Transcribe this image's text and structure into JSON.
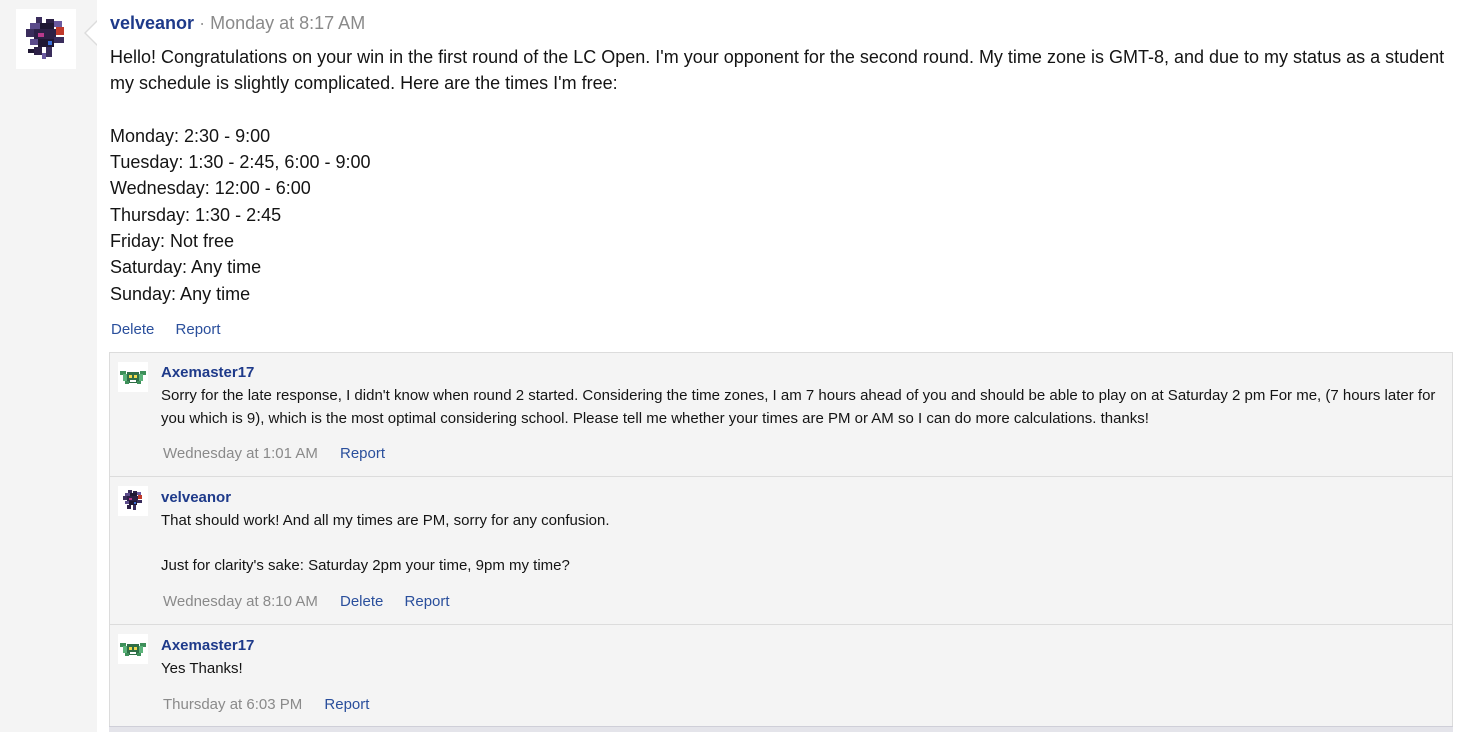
{
  "post": {
    "author": "velveanor",
    "separator": "·",
    "timestamp": "Monday at 8:17 AM",
    "intro": "Hello! Congratulations on your win in the first round of the LC Open. I'm your opponent for the second round. My time zone is GMT-8, and due to my status as a student my schedule is slightly complicated. Here are the times I'm free:",
    "schedule": [
      "Monday: 2:30 - 9:00",
      "Tuesday: 1:30 - 2:45, 6:00 - 9:00",
      "Wednesday: 12:00 - 6:00",
      "Thursday: 1:30 - 2:45",
      "Friday: Not free",
      "Saturday: Any time",
      "Sunday: Any time"
    ],
    "actions": {
      "delete": "Delete",
      "report": "Report"
    },
    "avatar_icon": "dark-purple-dragon-sprite-icon"
  },
  "comments": [
    {
      "author": "Axemaster17",
      "avatar_icon": "green-bat-sprite-icon",
      "lines": [
        "Sorry for the late response, I didn't know when round 2 started. Considering the time zones, I am 7 hours ahead of you and should be able to play on at Saturday 2 pm For me, (7 hours later for you which is 9), which is the most optimal considering school. Please tell me whether your times are PM or AM so I can do more calculations. thanks!"
      ],
      "time": "Wednesday at 1:01 AM",
      "report": "Report"
    },
    {
      "author": "velveanor",
      "avatar_icon": "dark-purple-dragon-sprite-icon",
      "line1": "That should work! And all my times are PM, sorry for any confusion.",
      "line2": "Just for clarity's sake: Saturday 2pm your time, 9pm my time?",
      "time": "Wednesday at 8:10 AM",
      "delete": "Delete",
      "report": "Report"
    },
    {
      "author": "Axemaster17",
      "avatar_icon": "green-bat-sprite-icon",
      "line1": "Yes Thanks!",
      "time": "Thursday at 6:03 PM",
      "report": "Report"
    }
  ],
  "colors": {
    "username": "#1e3a8a",
    "link": "#2a4f9c",
    "muted": "#8a8a8a",
    "page_bg": "#f4f4f4",
    "comment_border": "#dcdcdc"
  }
}
